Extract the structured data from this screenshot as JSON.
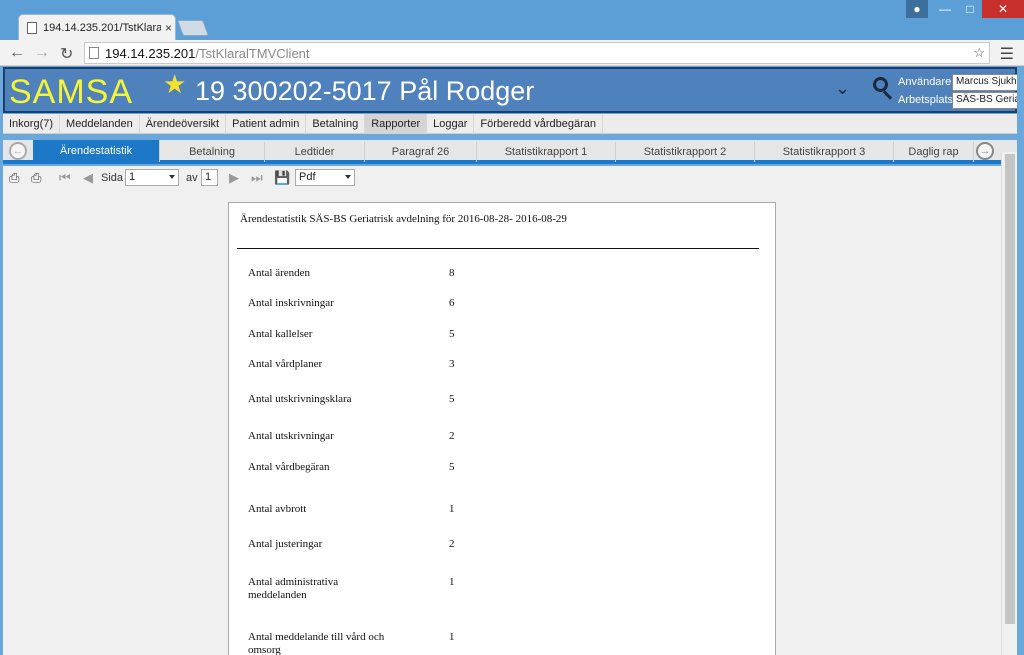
{
  "browser": {
    "tab_title": "194.14.235.201/TstKlaralT",
    "tab_close": "×",
    "url_host": "194.14.235.201",
    "url_path": "/TstKlaralTMVClient"
  },
  "header": {
    "logo": "SAMSA",
    "patient": "19 300202-5017 Pål Rodger",
    "user_label": "Användare:",
    "user_value": "Marcus Sjukh",
    "workplace_label": "Arbetsplats:",
    "workplace_value": "SÄS-BS Geriat",
    "colors": {
      "header_bg": "#4f81bd",
      "logo": "#f5f537",
      "accent": "#1e78c8"
    }
  },
  "mainmenu": [
    "Inkorg(7)",
    "Meddelanden",
    "Ärendeöversikt",
    "Patient admin",
    "Betalning",
    "Rapporter",
    "Loggar",
    "Förberedd vårdbegäran"
  ],
  "report_tabs": [
    "Ärendestatistik",
    "Betalning",
    "Ledtider",
    "Paragraf 26",
    "Statistikrapport 1",
    "Statistikrapport 2",
    "Statistikrapport 3",
    "Daglig rap"
  ],
  "toolbar": {
    "page_label": "Sida",
    "page_value": "1",
    "of_label": "av",
    "of_value": "1",
    "format_value": "Pdf"
  },
  "report": {
    "title": "Ärendestatistik SÄS-BS Geriatrisk avdelning för 2016-08-28- 2016-08-29",
    "rows": [
      {
        "label": "Antal ärenden",
        "value": "8"
      },
      {
        "label": "Antal inskrivningar",
        "value": "6"
      },
      {
        "label": "Antal kallelser",
        "value": "5"
      },
      {
        "label": "Antal vårdplaner",
        "value": "3"
      },
      {
        "label": "Antal utskrivningsklara",
        "value": "5"
      },
      {
        "label": "Antal utskrivningar",
        "value": "2"
      },
      {
        "label": "Antal vårdbegäran",
        "value": "5"
      },
      {
        "label": "Antal avbrott",
        "value": "1"
      },
      {
        "label": "Antal justeringar",
        "value": "2"
      },
      {
        "label": "Antal administrativa meddelanden",
        "value": "1"
      },
      {
        "label": "Antal meddelande till vård och omsorg",
        "value": "1"
      }
    ]
  }
}
